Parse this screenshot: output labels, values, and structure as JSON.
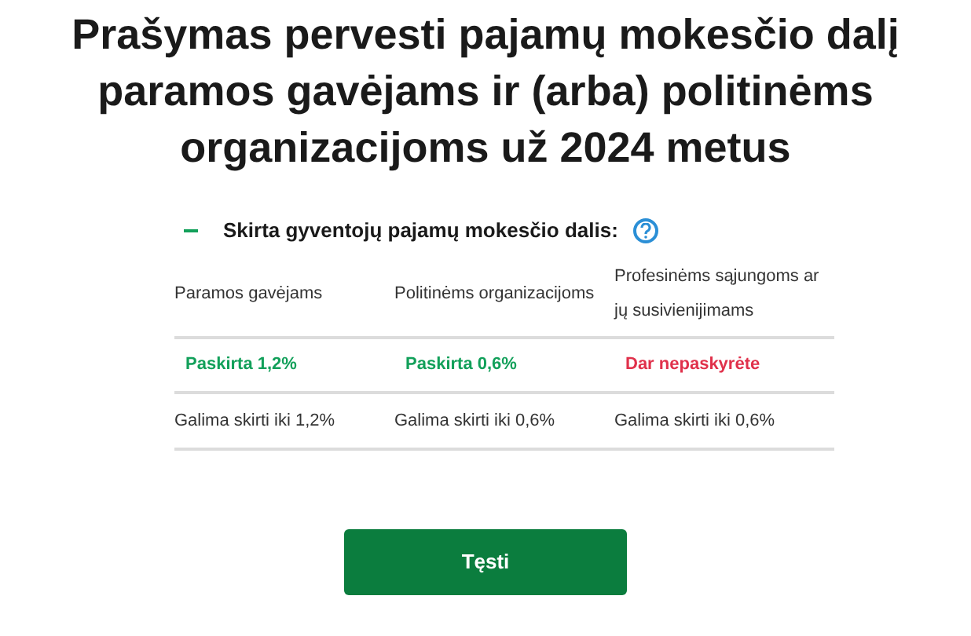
{
  "title": "Prašymas pervesti pajamų mokesčio dalį paramos gavėjams ir (arba) politinėms organizacijoms už 2024 metus",
  "section": {
    "heading": "Skirta gyventojų pajamų mokesčio dalis:",
    "expanded": true,
    "columns": [
      "Paramos gavėjams",
      "Politinėms organizacijoms",
      "Profesinėms sąjungoms ar jų susivienijimams"
    ],
    "statuses": [
      {
        "text": "Paskirta 1,2%",
        "kind": "assigned"
      },
      {
        "text": "Paskirta 0,6%",
        "kind": "assigned"
      },
      {
        "text": "Dar nepaskyrėte",
        "kind": "pending"
      }
    ],
    "limits": [
      "Galima skirti iki 1,2%",
      "Galima skirti iki 0,6%",
      "Galima skirti iki 0,6%"
    ]
  },
  "button": "Tęsti"
}
